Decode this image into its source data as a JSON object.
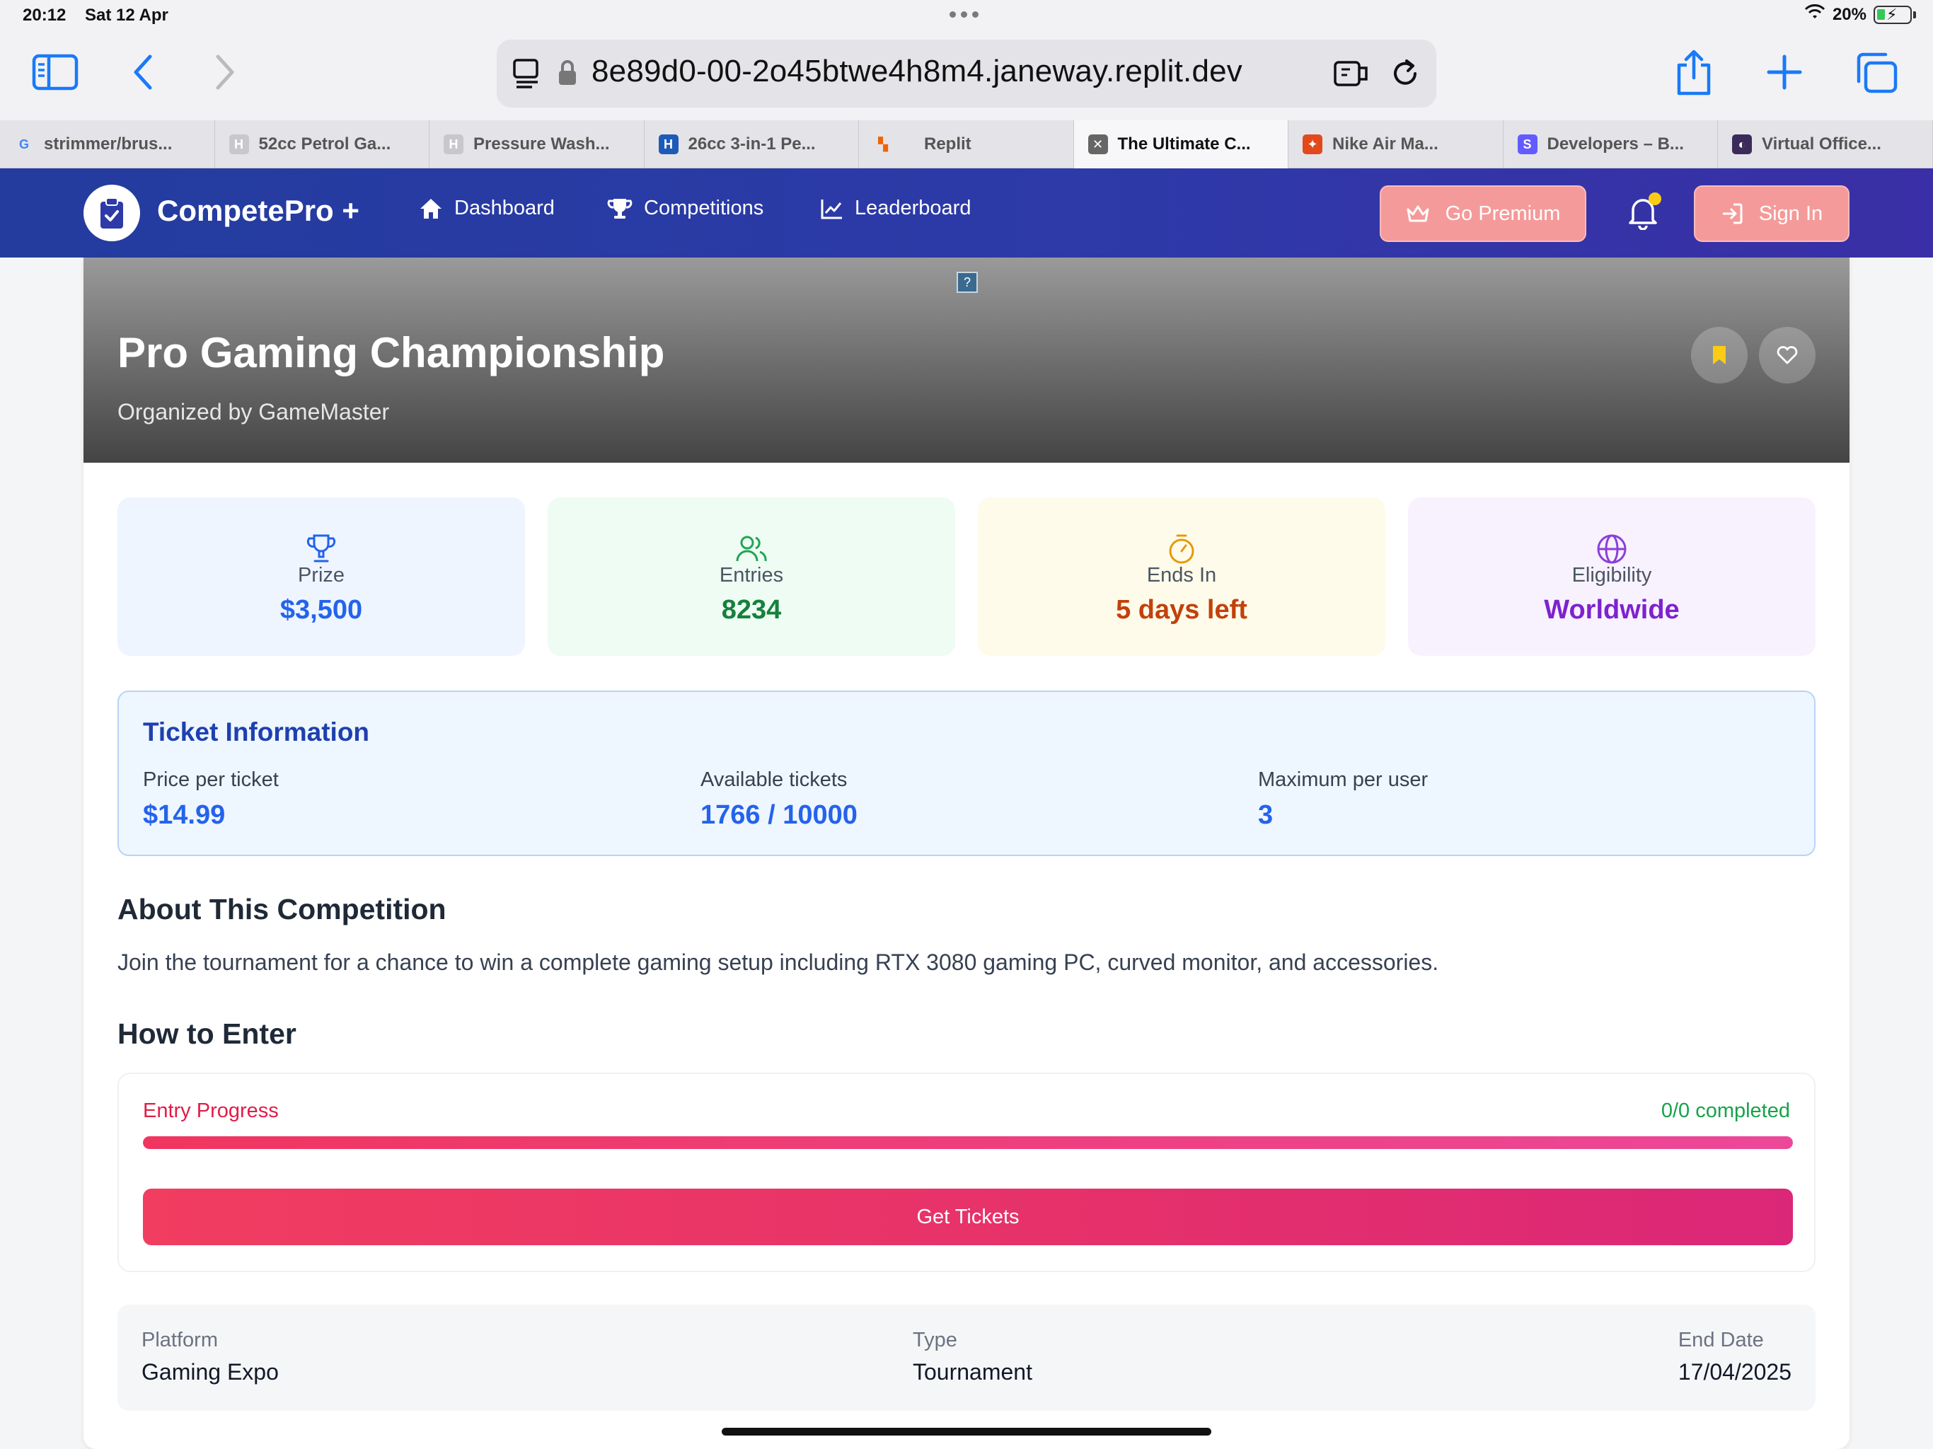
{
  "status": {
    "time": "20:12",
    "date": "Sat 12 Apr",
    "battery": "20%"
  },
  "browser": {
    "url": "8e89d0-00-2o45btwe4h8m4.janeway.replit.dev",
    "tabs": [
      {
        "label": "strimmer/brus...",
        "icon": "google-icon",
        "color": "#ffffff"
      },
      {
        "label": "52cc Petrol Ga...",
        "icon": "h-letter-icon",
        "color": "#c8c8cc"
      },
      {
        "label": "Pressure Wash...",
        "icon": "h-letter-icon",
        "color": "#c8c8cc"
      },
      {
        "label": "26cc 3-in-1 Pe...",
        "icon": "h-brand-icon",
        "color": "#1e5bb8"
      },
      {
        "label": "Replit",
        "icon": "replit-icon",
        "color": "#f26207"
      },
      {
        "label": "The Ultimate C...",
        "icon": "close-tab-icon",
        "color": "#666666"
      },
      {
        "label": "Nike Air Ma...",
        "icon": "nike-icon",
        "color": "#e24a1b"
      },
      {
        "label": "Developers – B...",
        "icon": "stripe-icon",
        "color": "#635bff"
      },
      {
        "label": "Virtual Office...",
        "icon": "virtual-office-icon",
        "color": "#3b2b5a"
      }
    ]
  },
  "nav": {
    "brand": "CompetePro +",
    "links": [
      "Dashboard",
      "Competitions",
      "Leaderboard"
    ],
    "premium": "Go Premium",
    "signin": "Sign In"
  },
  "competition": {
    "title": "Pro Gaming Championship",
    "organizer": "Organized by GameMaster",
    "stats": [
      {
        "label": "Prize",
        "value": "$3,500",
        "icon": "trophy-icon",
        "bg": "#eef5ff",
        "color": "#2463eb"
      },
      {
        "label": "Entries",
        "value": "8234",
        "icon": "users-icon",
        "bg": "#eefcf3",
        "color": "#15803d"
      },
      {
        "label": "Ends In",
        "value": "5 days left",
        "icon": "timer-icon",
        "bg": "#fffbea",
        "color": "#c2410c"
      },
      {
        "label": "Eligibility",
        "value": "Worldwide",
        "icon": "globe-icon",
        "bg": "#f8f2ff",
        "color": "#7e22ce"
      }
    ],
    "ticket": {
      "title": "Ticket Information",
      "price_label": "Price per ticket",
      "price": "$14.99",
      "available_label": "Available tickets",
      "available": "1766 / 10000",
      "max_label": "Maximum per user",
      "max": "3"
    },
    "about_heading": "About This Competition",
    "about_text": "Join the tournament for a chance to win a complete gaming setup including RTX 3080 gaming PC, curved monitor, and accessories.",
    "enter_heading": "How to Enter",
    "entry": {
      "label": "Entry Progress",
      "count": "0/0 completed",
      "progress": 1.0,
      "button": "Get Tickets"
    },
    "details": {
      "platform_label": "Platform",
      "platform": "Gaming Expo",
      "type_label": "Type",
      "type": "Tournament",
      "end_label": "End Date",
      "end": "17/04/2025"
    }
  }
}
